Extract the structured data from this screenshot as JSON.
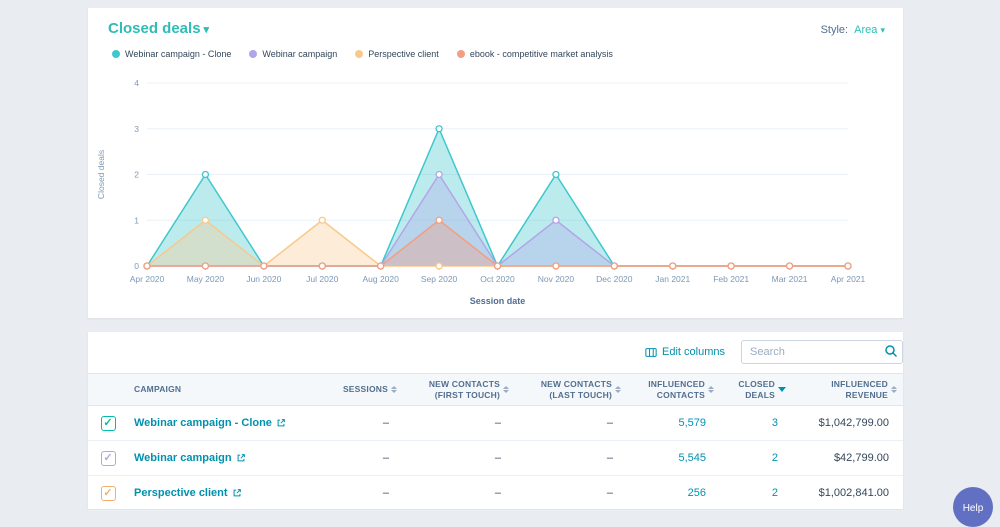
{
  "header": {
    "title": "Closed deals",
    "style_label": "Style:",
    "style_value": "Area"
  },
  "legend": {
    "items": [
      {
        "label": "Webinar campaign - Clone",
        "color": "#3ec7cd"
      },
      {
        "label": "Webinar campaign",
        "color": "#b3a5e8"
      },
      {
        "label": "Perspective client",
        "color": "#f8c98d"
      },
      {
        "label": "ebook - competitive market analysis",
        "color": "#f29e80"
      }
    ]
  },
  "chart_data": {
    "type": "area",
    "x": [
      "Apr 2020",
      "May 2020",
      "Jun 2020",
      "Jul 2020",
      "Aug 2020",
      "Sep 2020",
      "Oct 2020",
      "Nov 2020",
      "Dec 2020",
      "Jan 2021",
      "Feb 2021",
      "Mar 2021",
      "Apr 2021"
    ],
    "series": [
      {
        "name": "Webinar campaign - Clone",
        "color": "#3ec7cd",
        "values": [
          0,
          2,
          0,
          0,
          0,
          3,
          0,
          2,
          0,
          0,
          0,
          0,
          0
        ]
      },
      {
        "name": "Webinar campaign",
        "color": "#b3a5e8",
        "values": [
          0,
          0,
          0,
          0,
          0,
          2,
          0,
          1,
          0,
          0,
          0,
          0,
          0
        ]
      },
      {
        "name": "Perspective client",
        "color": "#f8c98d",
        "values": [
          0,
          1,
          0,
          1,
          0,
          0,
          0,
          0,
          0,
          0,
          0,
          0,
          0
        ]
      },
      {
        "name": "ebook - competitive market analysis",
        "color": "#f29e80",
        "values": [
          0,
          0,
          0,
          0,
          0,
          1,
          0,
          0,
          0,
          0,
          0,
          0,
          0
        ]
      }
    ],
    "title": "Closed deals",
    "xlabel": "Session date",
    "ylabel": "Closed deals",
    "ylim": [
      0,
      4
    ],
    "yticks": [
      0,
      1,
      2,
      3,
      4
    ],
    "grid": true,
    "legend_position": "top"
  },
  "controls": {
    "edit_columns": "Edit columns",
    "search_placeholder": "Search"
  },
  "table": {
    "columns": [
      {
        "label": "CAMPAIGN",
        "align": "left",
        "sort": "none"
      },
      {
        "label": "SESSIONS",
        "align": "right",
        "sort": "both"
      },
      {
        "label": "NEW CONTACTS (FIRST TOUCH)",
        "align": "right",
        "sort": "both"
      },
      {
        "label": "NEW CONTACTS (LAST TOUCH)",
        "align": "right",
        "sort": "both"
      },
      {
        "label": "INFLUENCED CONTACTS",
        "align": "right",
        "sort": "both"
      },
      {
        "label": "CLOSED DEALS",
        "align": "right",
        "sort": "desc"
      },
      {
        "label": "INFLUENCED REVENUE",
        "align": "right",
        "sort": "both"
      }
    ],
    "rows": [
      {
        "campaign": "Webinar campaign - Clone",
        "checkbox_color": "#00bda5",
        "sessions": "–",
        "new_contacts_first": "–",
        "new_contacts_last": "–",
        "influenced_contacts": "5,579",
        "closed_deals": "3",
        "influenced_revenue": "$1,042,799.00"
      },
      {
        "campaign": "Webinar campaign",
        "checkbox_color": "#b3a5e8",
        "sessions": "–",
        "new_contacts_first": "–",
        "new_contacts_last": "–",
        "influenced_contacts": "5,545",
        "closed_deals": "2",
        "influenced_revenue": "$42,799.00"
      },
      {
        "campaign": "Perspective client",
        "checkbox_color": "#f0b26b",
        "sessions": "–",
        "new_contacts_first": "–",
        "new_contacts_last": "–",
        "influenced_contacts": "256",
        "closed_deals": "2",
        "influenced_revenue": "$1,002,841.00"
      }
    ]
  },
  "help": {
    "label": "Help"
  },
  "colors": {
    "title_teal": "#2fbdb5",
    "link_teal": "#0091ae",
    "baseline": "#99acc2",
    "gridline": "#eaf0f6"
  }
}
